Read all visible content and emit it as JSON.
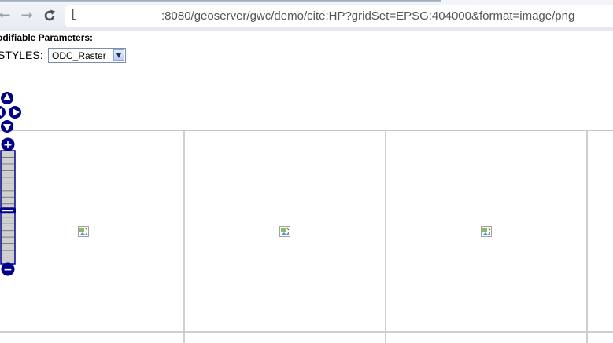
{
  "browser": {
    "back_glyph": "←",
    "forward_glyph": "→",
    "reload_glyph": "C",
    "address_caret": "[",
    "url": ":8080/geoserver/gwc/demo/cite:HP?gridSet=EPSG:404000&format=image/png"
  },
  "params": {
    "title": "odifiable Parameters:",
    "styles_label": "STYLES:",
    "styles_value": "ODC_Raster"
  },
  "map": {
    "zoom_in_glyph": "+",
    "zoom_out_glyph": "−",
    "zoom_level_index": 9,
    "zoom_level_count": 17,
    "colors": {
      "control": "#00008b",
      "tile_border": "#cfcfcf"
    }
  }
}
